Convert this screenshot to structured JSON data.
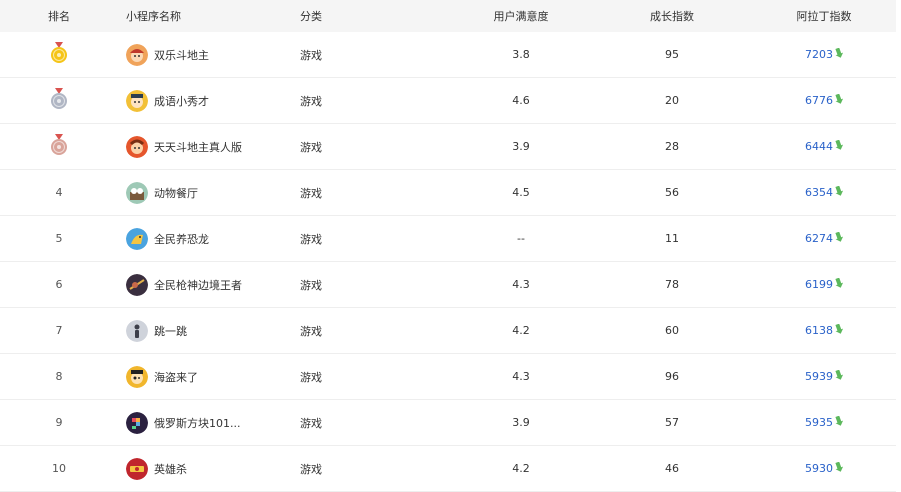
{
  "header": {
    "rank": "排名",
    "name": "小程序名称",
    "category": "分类",
    "satisfaction": "用户满意度",
    "growth": "成长指数",
    "aladdin": "阿拉丁指数"
  },
  "colors": {
    "link": "#2a62c9",
    "trend_arrow": "#5cb85c",
    "gold": "#f5c518",
    "silver": "#b0b6c4",
    "bronze": "#d9a49a"
  },
  "rows": [
    {
      "rank": "1",
      "medal": "gold",
      "avatar": "doudizhu-avatar",
      "name": "双乐斗地主",
      "category": "游戏",
      "satisfaction": "3.8",
      "growth": "95",
      "aladdin": "7203",
      "trend_icon": "trend-down-arrow-icon"
    },
    {
      "rank": "2",
      "medal": "silver",
      "avatar": "idiom-scholar-avatar",
      "name": "成语小秀才",
      "category": "游戏",
      "satisfaction": "4.6",
      "growth": "20",
      "aladdin": "6776",
      "trend_icon": "trend-down-arrow-icon"
    },
    {
      "rank": "3",
      "medal": "bronze",
      "avatar": "doudizhu-real-avatar",
      "name": "天天斗地主真人版",
      "category": "游戏",
      "satisfaction": "3.9",
      "growth": "28",
      "aladdin": "6444",
      "trend_icon": "trend-down-arrow-icon"
    },
    {
      "rank": "4",
      "medal": "",
      "avatar": "animal-restaurant-avatar",
      "name": "动物餐厅",
      "category": "游戏",
      "satisfaction": "4.5",
      "growth": "56",
      "aladdin": "6354",
      "trend_icon": "trend-down-arrow-icon"
    },
    {
      "rank": "5",
      "medal": "",
      "avatar": "dinosaur-avatar",
      "name": "全民养恐龙",
      "category": "游戏",
      "satisfaction": "--",
      "growth": "11",
      "aladdin": "6274",
      "trend_icon": "trend-down-arrow-icon"
    },
    {
      "rank": "6",
      "medal": "",
      "avatar": "gun-god-avatar",
      "name": "全民枪神边境王者",
      "category": "游戏",
      "satisfaction": "4.3",
      "growth": "78",
      "aladdin": "6199",
      "trend_icon": "trend-down-arrow-icon"
    },
    {
      "rank": "7",
      "medal": "",
      "avatar": "jump-avatar",
      "name": "跳一跳",
      "category": "游戏",
      "satisfaction": "4.2",
      "growth": "60",
      "aladdin": "6138",
      "trend_icon": "trend-down-arrow-icon"
    },
    {
      "rank": "8",
      "medal": "",
      "avatar": "pirate-avatar",
      "name": "海盗来了",
      "category": "游戏",
      "satisfaction": "4.3",
      "growth": "96",
      "aladdin": "5939",
      "trend_icon": "trend-down-arrow-icon"
    },
    {
      "rank": "9",
      "medal": "",
      "avatar": "tetris-avatar",
      "name": "俄罗斯方块101...",
      "category": "游戏",
      "satisfaction": "3.9",
      "growth": "57",
      "aladdin": "5935",
      "trend_icon": "trend-down-arrow-icon"
    },
    {
      "rank": "10",
      "medal": "",
      "avatar": "hero-kill-avatar",
      "name": "英雄杀",
      "category": "游戏",
      "satisfaction": "4.2",
      "growth": "46",
      "aladdin": "5930",
      "trend_icon": "trend-down-arrow-icon"
    }
  ]
}
